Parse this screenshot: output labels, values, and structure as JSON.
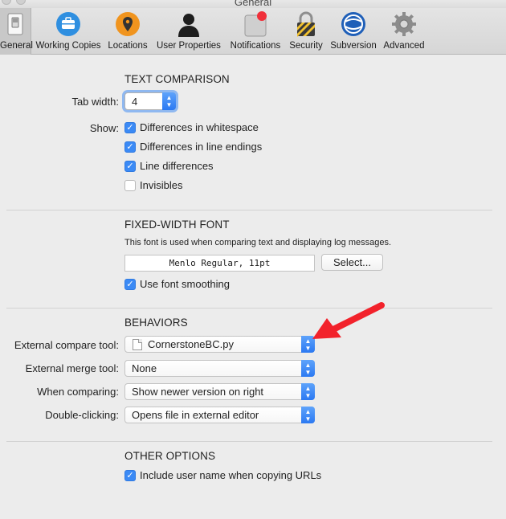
{
  "window": {
    "title": "General"
  },
  "toolbar": {
    "items": [
      {
        "label": "General",
        "icon": "switch-icon"
      },
      {
        "label": "Working Copies",
        "icon": "briefcase-icon"
      },
      {
        "label": "Locations",
        "icon": "map-pin-icon"
      },
      {
        "label": "User Properties",
        "icon": "user-silhouette-icon"
      },
      {
        "label": "Notifications",
        "icon": "notification-badge-icon"
      },
      {
        "label": "Security",
        "icon": "padlock-icon"
      },
      {
        "label": "Subversion",
        "icon": "subversion-globe-icon"
      },
      {
        "label": "Advanced",
        "icon": "gear-icon"
      }
    ]
  },
  "text_comparison": {
    "title": "TEXT COMPARISON",
    "tab_width_label": "Tab width:",
    "tab_width_value": "4",
    "show_label": "Show:",
    "options": [
      {
        "label": "Differences in whitespace",
        "checked": true
      },
      {
        "label": "Differences in line endings",
        "checked": true
      },
      {
        "label": "Line differences",
        "checked": true
      },
      {
        "label": "Invisibles",
        "checked": false
      }
    ]
  },
  "fixed_width_font": {
    "title": "FIXED-WIDTH FONT",
    "note": "This font is used when comparing text and displaying log messages.",
    "font_value": "Menlo Regular, 11pt",
    "select_label": "Select...",
    "smoothing_label": "Use font smoothing",
    "smoothing_checked": true
  },
  "behaviors": {
    "title": "BEHAVIORS",
    "compare_tool_label": "External compare tool:",
    "compare_tool_value": "CornerstoneBC.py",
    "merge_tool_label": "External merge tool:",
    "merge_tool_value": "None",
    "when_comparing_label": "When comparing:",
    "when_comparing_value": "Show newer version on right",
    "double_clicking_label": "Double-clicking:",
    "double_clicking_value": "Opens file in external editor"
  },
  "other_options": {
    "title": "OTHER OPTIONS",
    "include_user_label": "Include user name when copying URLs",
    "include_user_checked": true
  },
  "colors": {
    "accent": "#3b8af5",
    "annotation_arrow": "#f2222b"
  }
}
